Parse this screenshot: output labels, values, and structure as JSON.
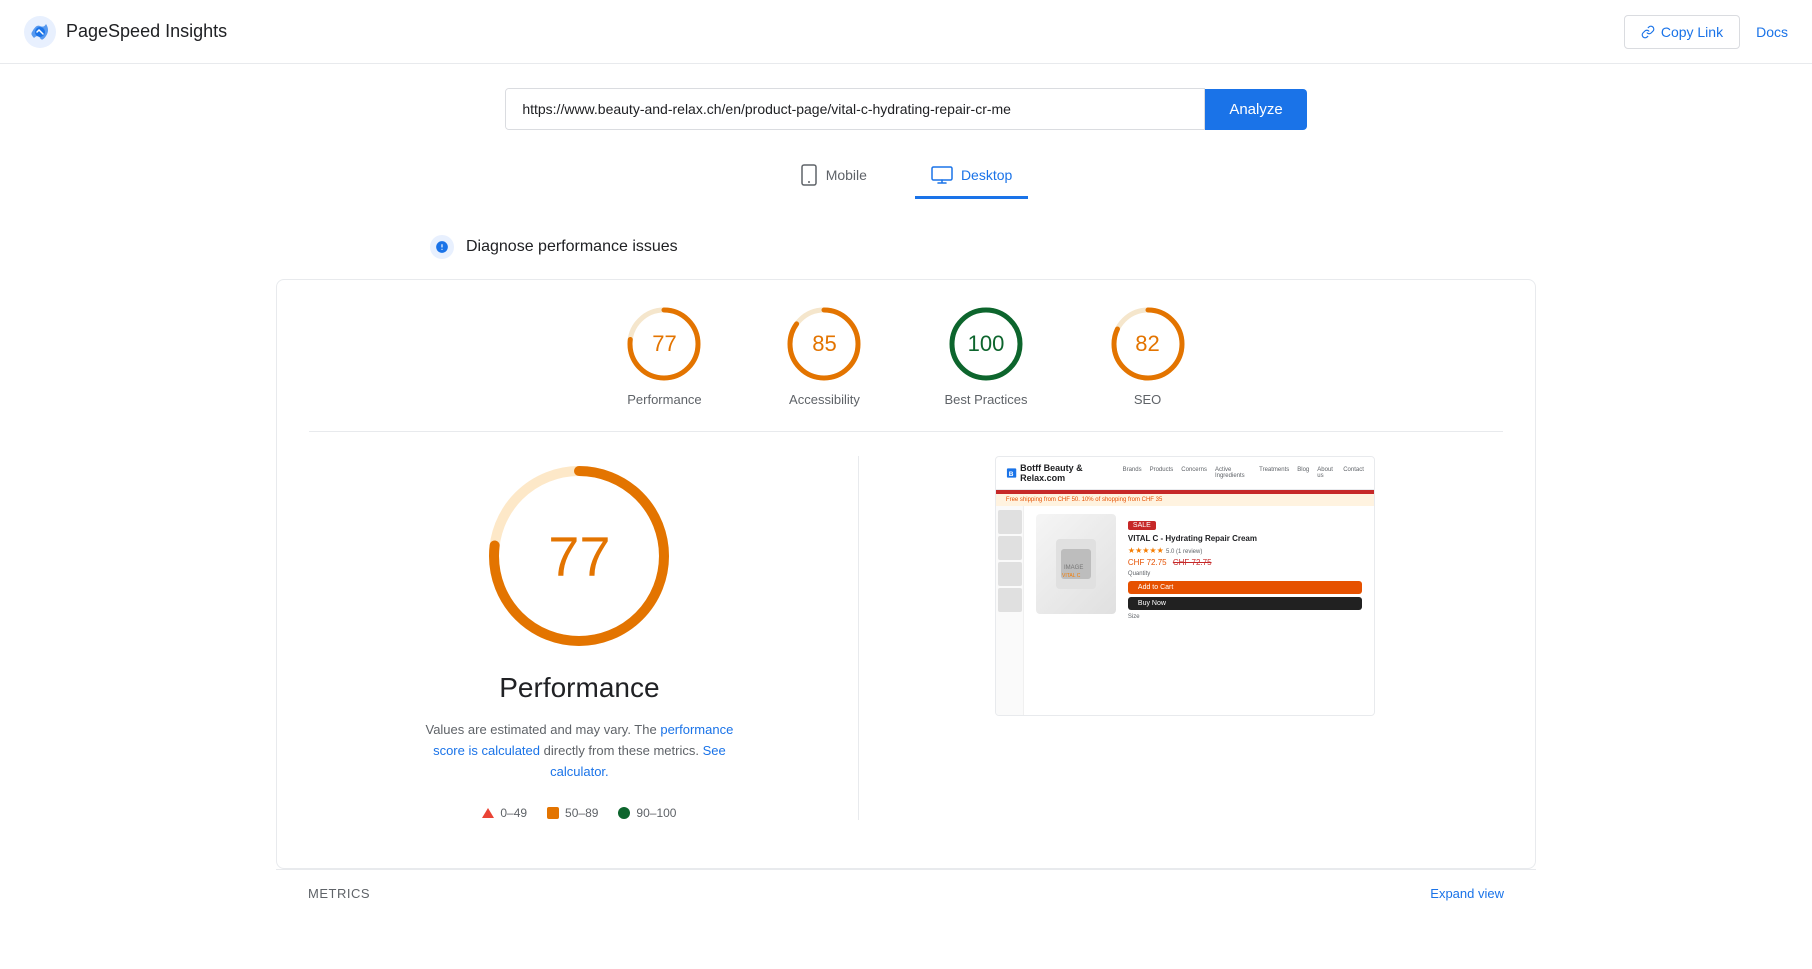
{
  "header": {
    "logo_text": "PageSpeed Insights",
    "copy_link_label": "Copy Link",
    "docs_label": "Docs"
  },
  "search": {
    "url_value": "https://www.beauty-and-relax.ch/en/product-page/vital-c-hydrating-repair-cr-me",
    "analyze_label": "Analyze"
  },
  "tabs": [
    {
      "id": "mobile",
      "label": "Mobile",
      "active": false
    },
    {
      "id": "desktop",
      "label": "Desktop",
      "active": true
    }
  ],
  "diagnose": {
    "text": "Diagnose performance issues"
  },
  "scores": [
    {
      "id": "performance",
      "label": "Performance",
      "value": 77,
      "color": "orange",
      "stroke": "#e37400"
    },
    {
      "id": "accessibility",
      "label": "Accessibility",
      "value": 85,
      "color": "orange",
      "stroke": "#e37400"
    },
    {
      "id": "best-practices",
      "label": "Best Practices",
      "value": 100,
      "color": "green",
      "stroke": "#0d652d"
    },
    {
      "id": "seo",
      "label": "SEO",
      "value": 82,
      "color": "orange",
      "stroke": "#e37400"
    }
  ],
  "big_score": {
    "value": 77,
    "title": "Performance",
    "description_before": "Values are estimated and may vary. The",
    "link1_text": "performance score is calculated",
    "description_middle": "directly from these metrics.",
    "link2_text": "See calculator.",
    "color": "#e37400"
  },
  "legend": [
    {
      "type": "triangle",
      "range": "0–49"
    },
    {
      "type": "square",
      "color": "#e37400",
      "range": "50–89"
    },
    {
      "type": "circle",
      "color": "#0d652d",
      "range": "90–100"
    }
  ],
  "metrics": {
    "label": "METRICS",
    "expand_label": "Expand view"
  },
  "screenshot": {
    "site_name": "Botff Beauty & Relax.com",
    "product_name": "VITAL C - Hydrating Repair Cream",
    "badge": "SALE",
    "price_old": "CHF 72.75",
    "price_new": "CHF 72.75",
    "stars": "★★★★★",
    "rating_count": "5.0 (1 review)",
    "nav_items": [
      "Brands",
      "Products",
      "Concerns",
      "Active Ingredients",
      "Treatments",
      "Blog",
      "About us",
      "Contact"
    ]
  }
}
